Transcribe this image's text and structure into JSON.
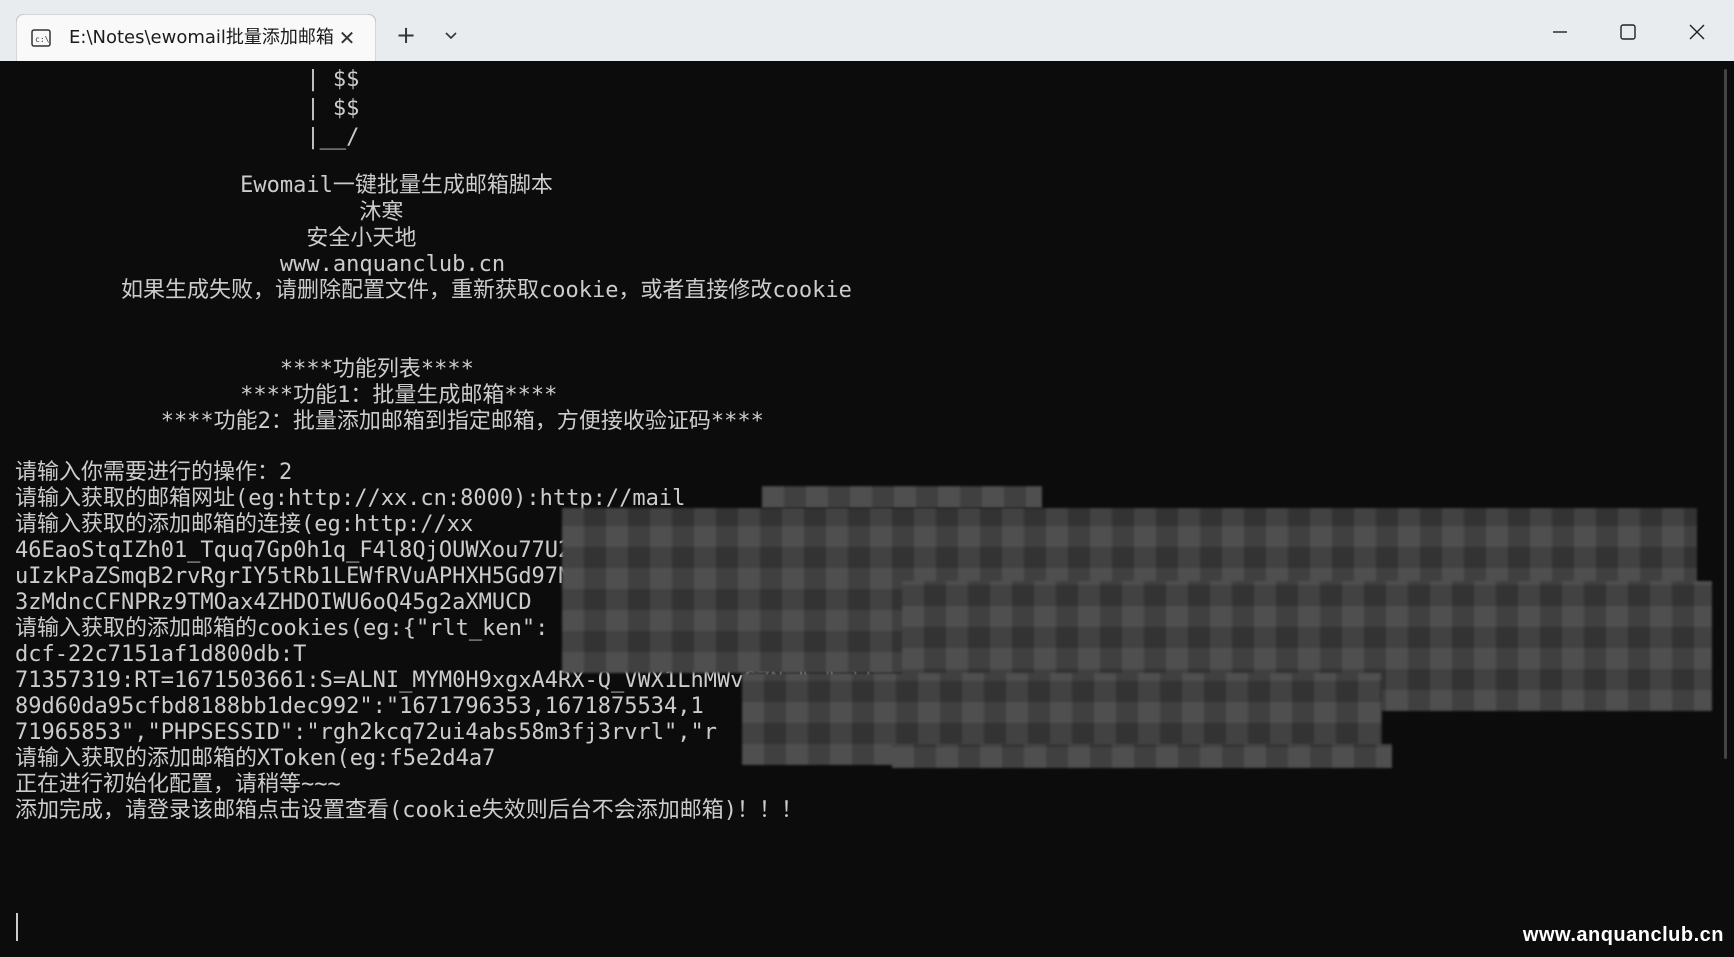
{
  "window": {
    "tab_title": "E:\\Notes\\ewomail批量添加邮箱",
    "tab_close_glyph": "✕",
    "new_tab_glyph": "+",
    "icons": {
      "tab": "terminal-icon",
      "dropdown": "chevron-down-icon",
      "minimize": "minimize-icon",
      "maximize": "maximize-icon",
      "close": "close-icon"
    }
  },
  "terminal": {
    "lines": [
      "                      | $$",
      "                      | $$",
      "                      |__/",
      "",
      "                 Ewomail一键批量生成邮箱脚本",
      "                          沐寒",
      "                      安全小天地",
      "                    www.anquanclub.cn",
      "        如果生成失败，请删除配置文件，重新获取cookie，或者直接修改cookie",
      "",
      "",
      "                    ****功能列表****",
      "                 ****功能1：批量生成邮箱****",
      "           ****功能2：批量添加邮箱到指定邮箱，方便接收验证码****",
      "",
      "请输入你需要进行的操作：2",
      "请输入获取的邮箱网址(eg:http://xx.cn:8000):http://mail",
      "请输入获取的添加邮箱的连接(eg:http://xx",
      "46EaoStqIZh01_Tquq7Gp0h1q_F4l8QjOUWXou77U26Lcw",
      "uIzkPaZSmqB2rvRgrIY5tRb1LEWfRVuAPHXH5Gd97N5J5AZ2tWLoGo H1BcDTHqt33OWgnroqu3-QSNf7uW3YAqMmNigvXVPt3UC9yO5Ce_9RFcmV",
      "3zMdncCFNPRz9TMOax4ZHDOIWU6oQ45g2aXMUCD",
      "请输入获取的添加邮箱的cookies(eg:{\"rlt_ken\": \"xxx\", \"rlsessio",
      "dcf-22c7151af1d800db:T",
      "71357319:RT=1671503661:S=ALNI_MYM0H9xgxA4RX-Q_VWX1LhMWv6ZNw\",\"rlt",
      "89d60da95cfbd8188bb1dec992\":\"1671796353,1671875534,1",
      "71965853\",\"PHPSESSID\":\"rgh2kcq72ui4abs58m3fj3rvrl\",\"r",
      "请输入获取的添加邮箱的XToken(eg:f5e2d4a7",
      "正在进行初始化配置，请稍等~~~",
      "添加完成，请登录该邮箱点击设置查看(cookie失效则后台不会添加邮箱)！！！"
    ]
  },
  "watermark": "www.anquanclub.cn"
}
